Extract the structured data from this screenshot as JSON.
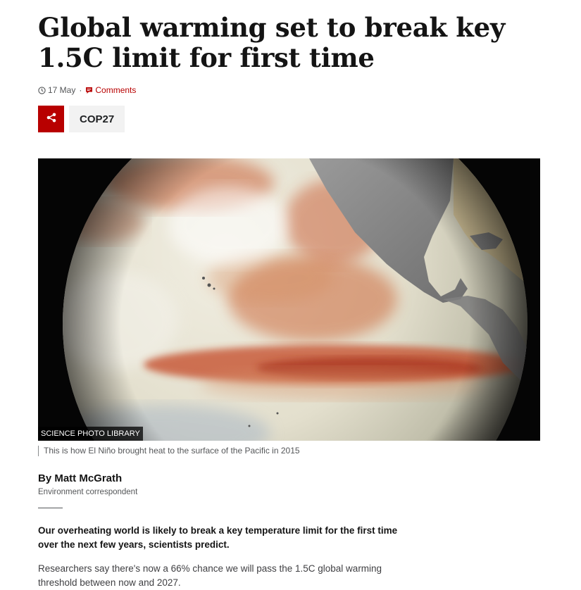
{
  "article": {
    "headline": "Global warming set to break key 1.5C limit for first time",
    "date": "17 May",
    "separator": "·",
    "comments_label": "Comments",
    "tag_label": "COP27",
    "image": {
      "credit": "SCIENCE PHOTO LIBRARY",
      "caption": "This is how El Niño brought heat to the surface of the Pacific in 2015"
    },
    "byline": {
      "name": "By Matt McGrath",
      "role": "Environment correspondent"
    },
    "intro": "Our overheating world is likely to break a key temperature limit for the first time over the next few years, scientists predict.",
    "paragraph": "Researchers say there's now a 66% chance we will pass the 1.5C global warming threshold between now and 2027."
  },
  "icons": {
    "clock": "clock-icon",
    "comment": "comment-icon",
    "share": "share-icon"
  },
  "colors": {
    "accent": "#b80000",
    "tag_bg": "#f2f2f2",
    "text": "#141414",
    "muted": "#545658"
  }
}
